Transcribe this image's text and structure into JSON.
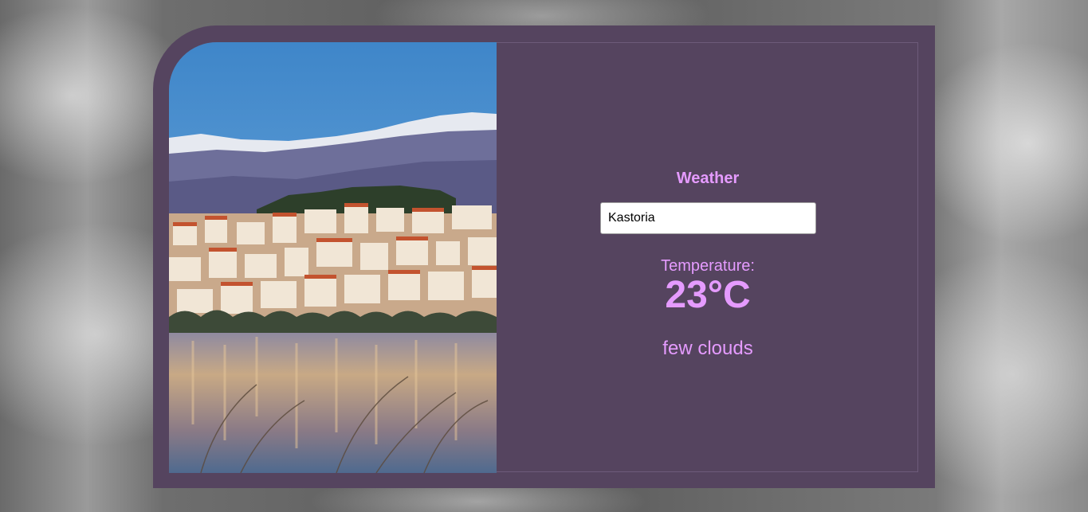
{
  "app": {
    "heading": "Weather"
  },
  "search": {
    "value": "Kastoria"
  },
  "weather": {
    "temperature_label": "Temperature:",
    "temperature_value": "23°C",
    "description": "few clouds"
  },
  "colors": {
    "card_background": "#55445f",
    "accent_text": "#e59bff",
    "input_background": "#ffffff"
  },
  "icons": {
    "city_photo": "kastoria-lakeside-photo"
  }
}
